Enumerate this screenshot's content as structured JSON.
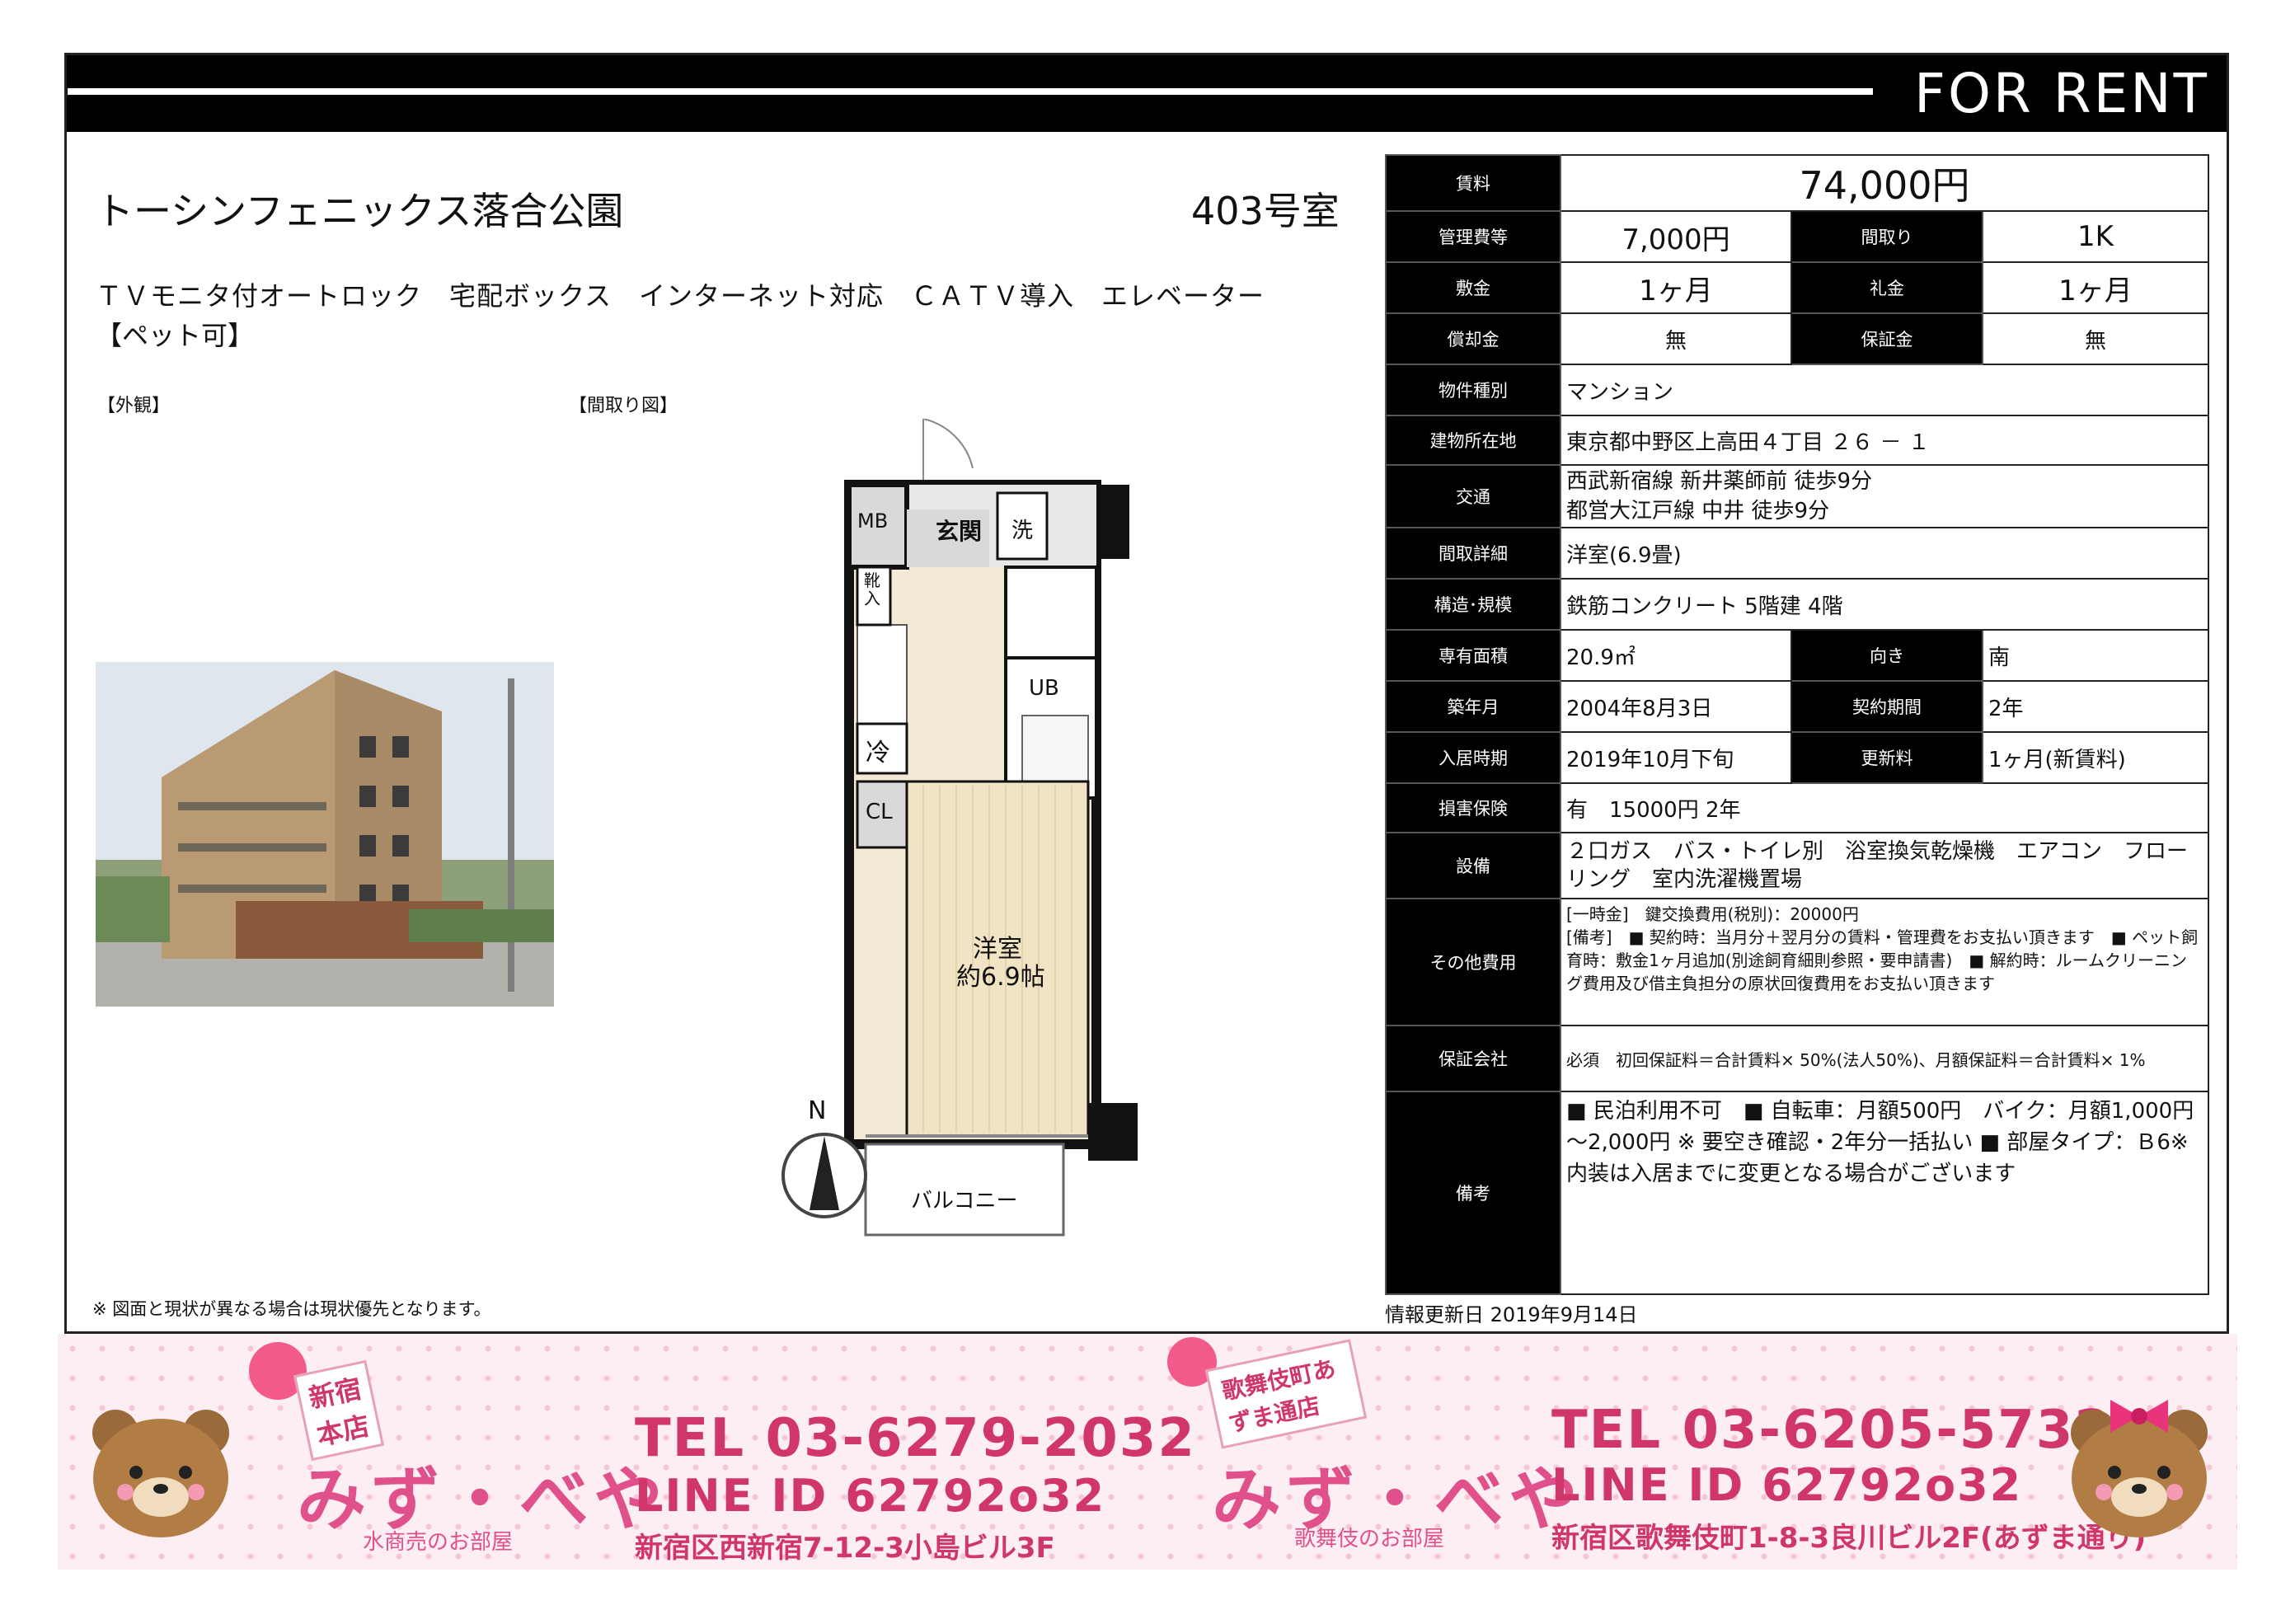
{
  "header": {
    "label": "FOR RENT"
  },
  "property": {
    "name": "トーシンフェニックス落合公園",
    "room": "403号室",
    "features": "ＴＶモニタ付オートロック　宅配ボックス　インターネット対応　ＣＡＴＶ導入　エレベーター",
    "pet": "【ペット可】",
    "exterior_label": "【外観】",
    "floorplan_label": "【間取り図】",
    "disclaimer": "※ 図面と現状が異なる場合は現状優先となります。",
    "update": "情報更新日 2019年9月14日"
  },
  "floorplan": {
    "mb": "MB",
    "genkan": "玄関",
    "sen": "洗",
    "kutsu": "靴入",
    "ub": "UB",
    "rei": "冷",
    "cl": "CL",
    "room1": "洋室",
    "room2": "約6.9帖",
    "balcony": "バルコニー",
    "north": "N"
  },
  "table": {
    "rent_label": "賃料",
    "rent": "74,000円",
    "kanri_label": "管理費等",
    "kanri": "7,000円",
    "madori_label": "間取り",
    "madori": "1K",
    "shikikin_label": "敷金",
    "shikikin": "1ヶ月",
    "reikin_label": "礼金",
    "reikin": "1ヶ月",
    "shokyaku_label": "償却金",
    "shokyaku": "無",
    "hoshokin_label": "保証金",
    "hoshokin": "無",
    "shubetsu_label": "物件種別",
    "shubetsu": "マンション",
    "address_label": "建物所在地",
    "address": "東京都中野区上高田４丁目 ２６ － １",
    "kotsu_label": "交通",
    "kotsu1": "西武新宿線 新井薬師前 徒歩9分",
    "kotsu2": "都営大江戸線 中井 徒歩9分",
    "detail_label": "間取詳細",
    "detail": "洋室(6.9畳)",
    "kozo_label": "構造･規模",
    "kozo": "鉄筋コンクリート 5階建 4階",
    "area_label": "専有面積",
    "area": "20.9㎡",
    "muki_label": "向き",
    "muki": "南",
    "built_label": "築年月",
    "built": "2004年8月3日",
    "keiyaku_label": "契約期間",
    "keiyaku": "2年",
    "nyukyo_label": "入居時期",
    "nyukyo": "2019年10月下旬",
    "koshin_label": "更新料",
    "koshin": "1ヶ月(新賃料)",
    "hoken_label": "損害保険",
    "hoken": "有　15000円 2年",
    "setsubi_label": "設備",
    "setsubi": "２口ガス　バス・トイレ別　浴室換気乾燥機　エアコン　フローリング　室内洗濯機置場",
    "sonota_label": "その他費用",
    "sonota1": "[一時金]　鍵交換費用(税別)：20000円",
    "sonota2": "[備考]　■ 契約時：当月分＋翌月分の賃料・管理費をお支払い頂きます　■ ペット飼育時：敷金1ヶ月追加(別途飼育細則参照・要申請書)　■ 解約時：ルームクリーニング費用及び借主負担分の原状回復費用をお支払い頂きます",
    "hosho_label": "保証会社",
    "hosho": "必須　初回保証料＝合計賃料× 50%(法人50%)、月額保証料＝合計賃料× 1%",
    "biko_label": "備考",
    "biko": "■ 民泊利用不可　■ 自転車：月額500円　バイク：月額1,000円～2,000円 ※ 要空き確認・2年分一括払い ■ 部屋タイプ：Ｂ6※内装は入居までに変更となる場合がございます"
  },
  "banner": {
    "left": {
      "tag1": "新宿",
      "tag2": "本店",
      "logo": "みず・べや",
      "sub": "水商売のお部屋",
      "tel": "TEL 03-6279-2032",
      "line": "LINE ID 62792o32",
      "addr": "新宿区西新宿7-12-3小島ビル3F"
    },
    "right": {
      "tag": "歌舞伎町あずま通店",
      "logo": "みず・べや",
      "sub": "歌舞伎のお部屋",
      "tel": "TEL 03-6205-5732",
      "line": "LINE ID 62792o32",
      "addr": "新宿区歌舞伎町1-8-3良川ビル2F(あずま通り)"
    }
  }
}
